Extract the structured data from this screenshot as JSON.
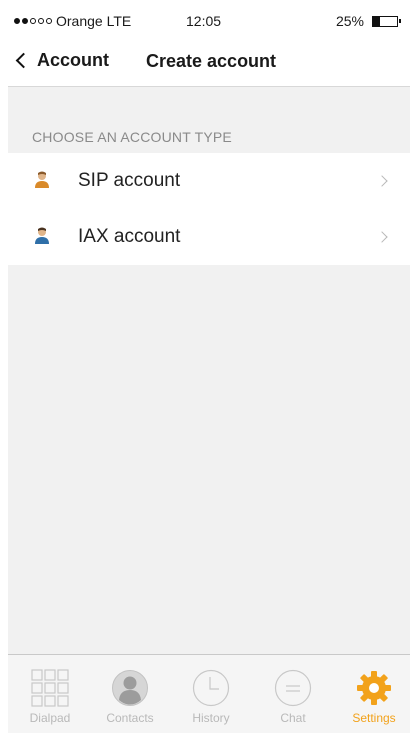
{
  "status_bar": {
    "carrier": "Orange LTE",
    "time": "12:05",
    "battery": "25%",
    "signal_dots_filled": 2,
    "signal_dots_total": 5
  },
  "nav": {
    "back_label": "Account",
    "title": "Create account"
  },
  "section": {
    "header": "CHOOSE AN ACCOUNT TYPE",
    "items": [
      {
        "label": "SIP account",
        "icon": "user-avatar-icon-orange"
      },
      {
        "label": "IAX account",
        "icon": "user-avatar-icon-blue"
      }
    ]
  },
  "tab_bar": {
    "tabs": [
      {
        "label": "Dialpad",
        "icon": "dialpad-icon",
        "active": false
      },
      {
        "label": "Contacts",
        "icon": "contacts-icon",
        "active": false
      },
      {
        "label": "History",
        "icon": "clock-icon",
        "active": false
      },
      {
        "label": "Chat",
        "icon": "chat-icon",
        "active": false
      },
      {
        "label": "Settings",
        "icon": "gear-icon",
        "active": true
      }
    ]
  },
  "colors": {
    "accent": "#f2a21b",
    "inactive_tab": "#b9b9b9",
    "section_bg": "#f1f1f1"
  }
}
